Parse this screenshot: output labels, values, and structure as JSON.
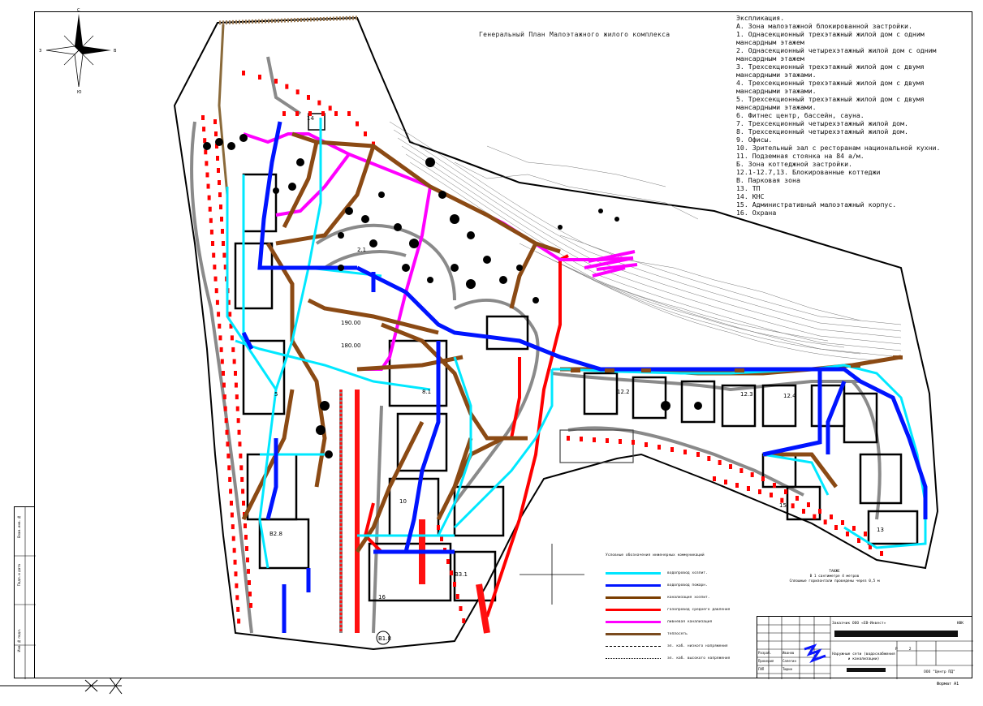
{
  "plan_title": "Генеральный План Малоэтажного жилого комплекса",
  "explication": {
    "heading": "Экспликация.",
    "items": [
      "А. Зона малоэтажной блокированной застройки.",
      "1. Однасекционный трехэтажный жилой дом с одним мансардным этажем",
      "2. Однасекционный четырехэтажный жилой дом с одним мансардным этажем",
      "3. Трехсекционный трехэтажный жилой дом с двумя мансардными этажами.",
      "4. Трехсекционный трехэтажный жилой дом с двумя мансардными этажами.",
      "5. Трехсекционный трехэтажный жилой дом с двумя мансардными этажами.",
      "6. Фитнес центр, бассейн, сауна.",
      "7. Трехсекционный четырехэтажный жилой дом.",
      "8. Трехсекционный четырехэтажный жилой дом.",
      "9.   Офисы.",
      "10. Зрительный зал с ресторанам национальной кухни.",
      "11. Подземная стоянка на 84 а/м.",
      "Б. Зона коттеджной застройки.",
      "12.1-12.7,13. Блокированные коттеджи",
      "В. Парковая зона",
      "13. ТП",
      "14. КНС",
      "15. Административный малоэтажный корпус.",
      "16. Охрана"
    ]
  },
  "compass": {
    "n": "С",
    "s": "Ю",
    "w": "З",
    "e": "В"
  },
  "map_labels": [
    "14",
    "2.1",
    "1.2",
    "1.3",
    "1.4",
    "3.1",
    "5",
    "7",
    "8",
    "8.1",
    "10",
    "12.1",
    "12.2",
    "12.3",
    "12.4",
    "13",
    "15",
    "16",
    "B1.8",
    "B2.8",
    "B3.1",
    "190.00",
    "180.00"
  ],
  "legend": {
    "title": "Условные обозначения инженерных коммуникаций",
    "items": [
      {
        "label": "водопровод хозпит.",
        "color": "#00e5ff"
      },
      {
        "label": "водопровод пожарн.",
        "color": "#0014ff"
      },
      {
        "label": "канализация хозпит.",
        "color": "#7a3d00"
      },
      {
        "label": "газопровод среднего давления",
        "color": "#ff0000"
      },
      {
        "label": "ливневая канализация",
        "color": "#ff00ff"
      },
      {
        "label": "теплосеть",
        "color": "#7a4a1e"
      },
      {
        "label": "эл. каб. низкого напряжения",
        "color": "#000000"
      },
      {
        "label": "эл. каб. высокого напряжения",
        "color": "#000000"
      }
    ]
  },
  "note": {
    "line1": "ТАКЖЕ",
    "line2": "В 1 сантиметре 4 метров",
    "line3": "Сплошные горизонтали проведены через 0,5 м"
  },
  "stamp": {
    "customer": "Заказчик ООО «ЕВ-Инвест»",
    "code": "НВК",
    "object": "Наружные сети (водоснабжения и канализации)",
    "stage": "Р",
    "sheet": "2",
    "organization": "ООО \"Центр ПД\"",
    "roles": [
      "Разраб.",
      "Проверил",
      "ГИП"
    ],
    "names": [
      "Иванов",
      "Сапегин",
      "Тюрин"
    ]
  },
  "format": "Формат А1",
  "left_strip": [
    "Инв. № подл.",
    "Подп. и дата",
    "Взам. инв. №"
  ]
}
